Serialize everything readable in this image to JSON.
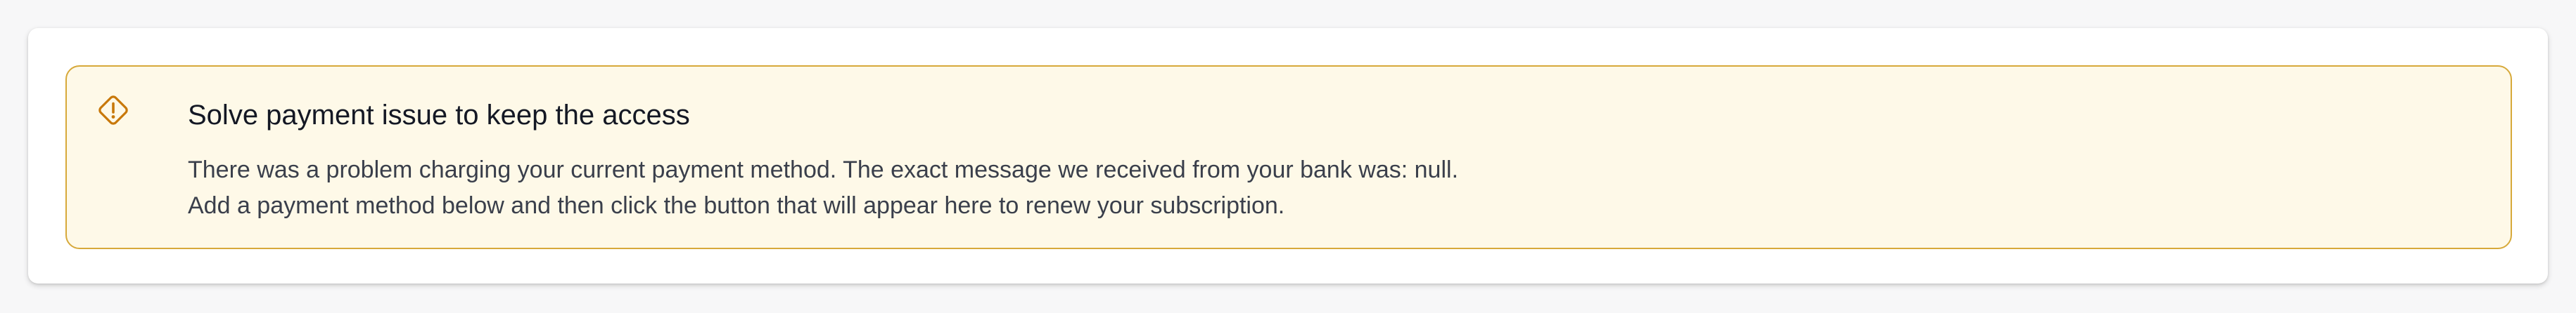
{
  "alert": {
    "icon": "warning-diamond-icon",
    "title": "Solve payment issue to keep the access",
    "lines": [
      "There was a problem charging your current payment method. The exact message we received from your bank was: null.",
      "Add a payment method below and then click the button that will appear here to renew your subscription."
    ],
    "colors": {
      "background": "#fef9e8",
      "border": "#d7a93a",
      "icon": "#c8780a"
    }
  }
}
